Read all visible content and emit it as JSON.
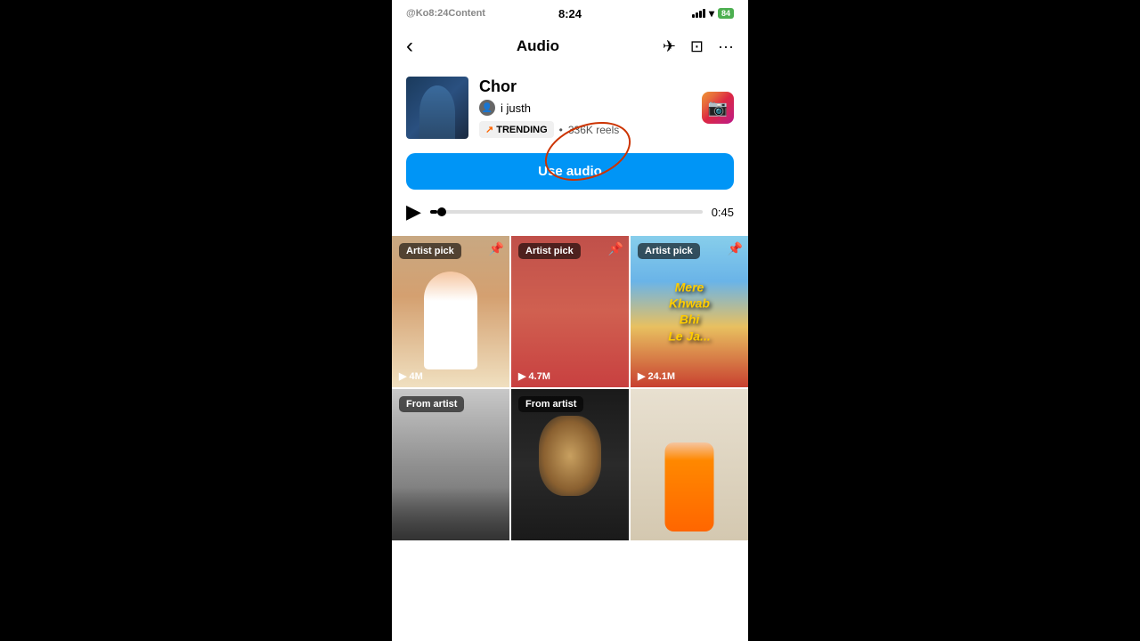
{
  "statusBar": {
    "handle": "@Ko8:24Content",
    "time": "8:24",
    "battery": "84"
  },
  "header": {
    "title": "Audio",
    "backLabel": "‹",
    "shareLabel": "✈",
    "saveLabel": "⊡",
    "moreLabel": "···"
  },
  "track": {
    "name": "Chor",
    "artist": "i justh",
    "trendingLabel": "TRENDING",
    "reelCount": "336K reels",
    "useAudioLabel": "Use audio",
    "duration": "0:45"
  },
  "videos": [
    {
      "badge": "Artist pick",
      "pinned": true,
      "viewCount": "▶ 4M",
      "type": "woman-white"
    },
    {
      "badge": "Artist pick",
      "pinned": true,
      "viewCount": "▶ 4.7M",
      "type": "woman-red"
    },
    {
      "badge": "Artist pick",
      "pinned": true,
      "viewCount": "▶ 24.1M",
      "type": "text-card",
      "textContent": "Mere\nKhwab\nBhi\nLe Ja..."
    },
    {
      "badge": "From artist",
      "pinned": false,
      "viewCount": "",
      "type": "audience"
    },
    {
      "badge": "From artist",
      "pinned": false,
      "viewCount": "",
      "type": "face"
    },
    {
      "badge": "",
      "pinned": false,
      "viewCount": "",
      "type": "woman-dance"
    }
  ]
}
